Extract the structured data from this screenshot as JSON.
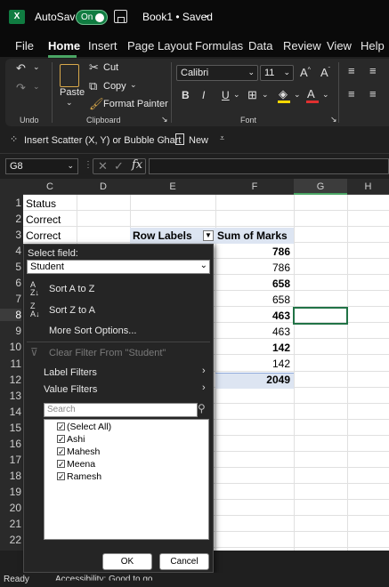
{
  "titlebar": {
    "autosave_label": "AutoSave",
    "toggle_state": "On",
    "doc_title": "Book1 • Saved",
    "logo": "X"
  },
  "tabs": [
    "File",
    "Home",
    "Insert",
    "Page Layout",
    "Formulas",
    "Data",
    "Review",
    "View",
    "Help"
  ],
  "ribbon": {
    "undo_group": "Undo",
    "clipboard_group": "Clipboard",
    "font_group": "Font",
    "paste": "Paste",
    "cut": "Cut",
    "copy": "Copy",
    "format_painter": "Format Painter",
    "font_name": "Calibri",
    "font_size": "11",
    "bold": "B",
    "italic": "I",
    "underline": "U",
    "grow": "A^",
    "shrink": "Aˇ"
  },
  "quick_access": {
    "insert_scatter": "Insert Scatter (X, Y) or Bubble Chart",
    "new": "New"
  },
  "formula_bar": {
    "name_box": "G8",
    "fx": "fx"
  },
  "columns": [
    "C",
    "D",
    "E",
    "F",
    "G",
    "H"
  ],
  "rows": [
    "1",
    "2",
    "3",
    "4",
    "5",
    "6",
    "7",
    "8",
    "9",
    "10",
    "11",
    "12",
    "13",
    "14",
    "15",
    "16",
    "17",
    "18",
    "19",
    "20",
    "21",
    "22"
  ],
  "cells": {
    "c1": "Status",
    "c2": "Correct",
    "c3": "Correct",
    "e3": "Row Labels",
    "f3": "Sum of Marks",
    "f4": "786",
    "f5": "786",
    "f6": "658",
    "f7": "658",
    "f8": "463",
    "f9": "463",
    "f10": "142",
    "f11": "142",
    "f12": "2049"
  },
  "dropdown": {
    "select_field_label": "Select field:",
    "selected_field": "Student",
    "sort_az": "Sort A to Z",
    "sort_za": "Sort Z to A",
    "more_sort": "More Sort Options...",
    "clear_filter": "Clear Filter From \"Student\"",
    "label_filters": "Label Filters",
    "value_filters": "Value Filters",
    "search_placeholder": "Search",
    "items": [
      "(Select All)",
      "Ashi",
      "Mahesh",
      "Meena",
      "Ramesh"
    ],
    "ok": "OK",
    "cancel": "Cancel"
  },
  "status": {
    "ready": "Ready",
    "accessibility": "Accessibility: Good to go"
  },
  "colors": {
    "accent": "#107c41",
    "pivot_header": "#dde5f2",
    "selection": "#217346"
  }
}
